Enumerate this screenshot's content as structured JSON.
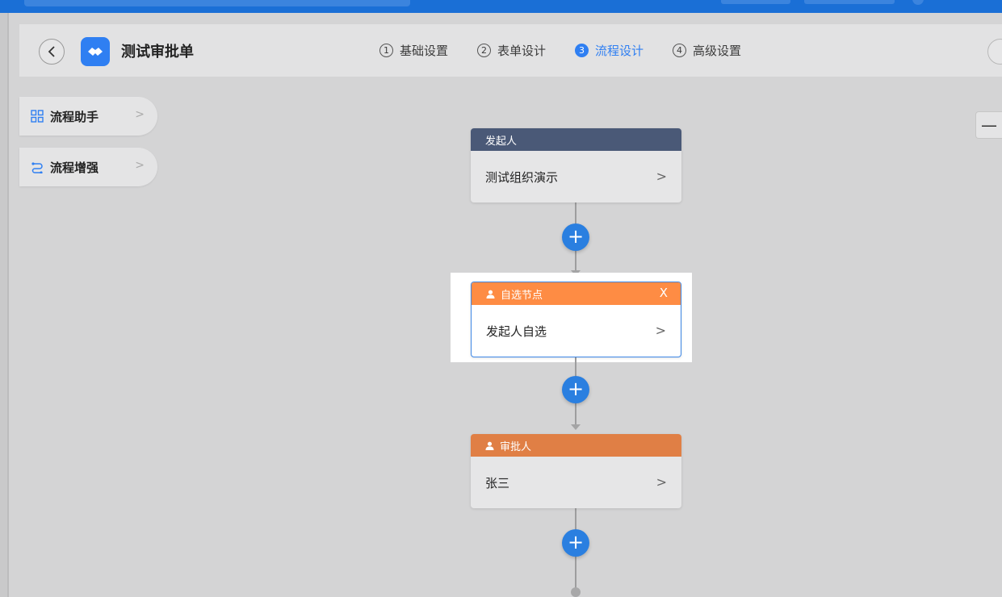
{
  "header": {
    "title": "测试审批单",
    "steps": [
      {
        "num": "1",
        "label": "基础设置"
      },
      {
        "num": "2",
        "label": "表单设计"
      },
      {
        "num": "3",
        "label": "流程设计"
      },
      {
        "num": "4",
        "label": "高级设置"
      }
    ],
    "active_step": "3"
  },
  "sidebar": {
    "items": [
      {
        "label": "流程助手",
        "icon": "grid-icon"
      },
      {
        "label": "流程增强",
        "icon": "flow-link-icon"
      }
    ]
  },
  "zoom": {
    "minus": "—"
  },
  "nodes": [
    {
      "type": "initiator",
      "header": "发起人",
      "body": "测试组织演示",
      "color": "#4a5977"
    },
    {
      "type": "self-select",
      "header": "自选节点",
      "body": "发起人自选",
      "color": "#fe8c44",
      "selected": true,
      "close": "X"
    },
    {
      "type": "approver",
      "header": "审批人",
      "body": "张三",
      "color": "#e07f45"
    }
  ],
  "colors": {
    "accent": "#2f7ff2",
    "topbar": "#1a6fd6"
  }
}
